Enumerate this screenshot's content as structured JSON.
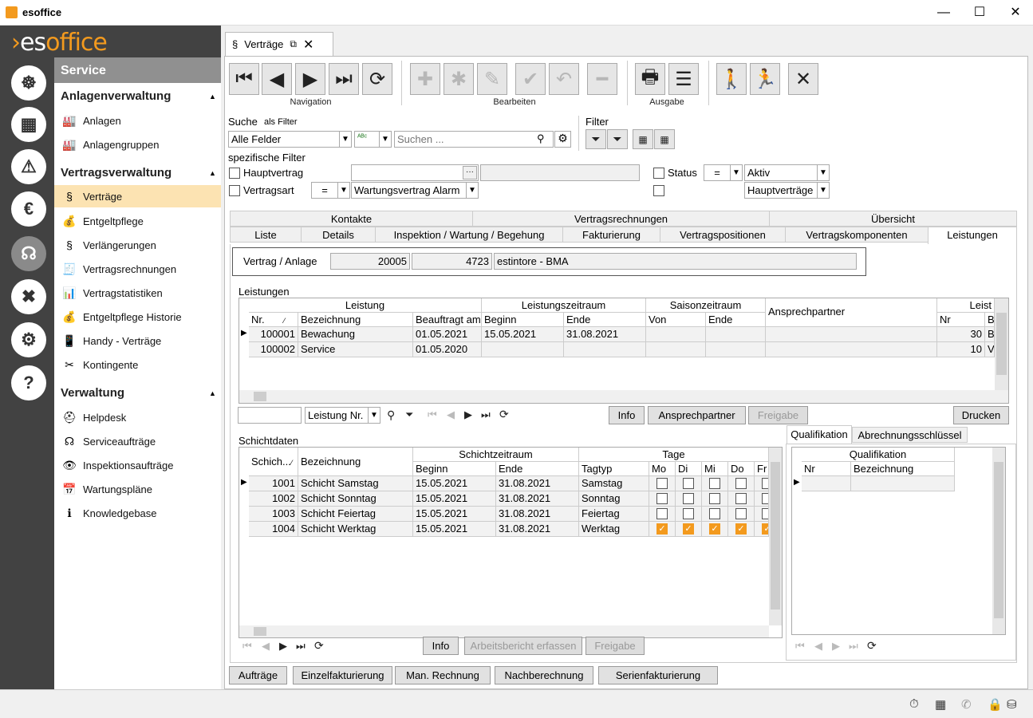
{
  "window": {
    "title": "esoffice",
    "min": "—",
    "max": "☐",
    "close": "✕"
  },
  "brand": {
    "logo_a": "es",
    "logo_b": "office"
  },
  "nav": {
    "title": "Service",
    "groups": [
      {
        "label": "Anlagenverwaltung",
        "items": [
          {
            "label": "Anlagen"
          },
          {
            "label": "Anlagengruppen"
          }
        ]
      },
      {
        "label": "Vertragsverwaltung",
        "items": [
          {
            "label": "Verträge"
          },
          {
            "label": "Entgeltpflege"
          },
          {
            "label": "Verlängerungen"
          },
          {
            "label": "Vertragsrechnungen"
          },
          {
            "label": "Vertragstatistiken"
          },
          {
            "label": "Entgeltpflege Historie"
          },
          {
            "label": "Handy - Verträge"
          },
          {
            "label": "Kontingente"
          }
        ]
      },
      {
        "label": "Verwaltung",
        "items": [
          {
            "label": "Helpdesk"
          },
          {
            "label": "Serviceaufträge"
          },
          {
            "label": "Inspektionsaufträge"
          },
          {
            "label": "Wartungspläne"
          },
          {
            "label": "Knowledgebase"
          }
        ]
      }
    ]
  },
  "doc_tab": {
    "label": "Verträge"
  },
  "toolbar": {
    "groups": [
      "Navigation",
      "Bearbeiten",
      "Ausgabe"
    ]
  },
  "search": {
    "label": "Suche",
    "as_filter": "als Filter",
    "field": "Alle Felder",
    "placeholder": "Suchen ...",
    "filter_label": "Filter"
  },
  "specific": {
    "title": "spezifische Filter",
    "hauptvertrag": "Hauptvertrag",
    "vertragsart": "Vertragsart",
    "op": "=",
    "vertragsart_value": "Wartungsvertrag Alarm",
    "status": "Status",
    "status_value": "Aktiv",
    "extra_value": "Hauptverträge"
  },
  "tabs": {
    "row1": [
      "Kontakte",
      "Vertragsrechnungen",
      "Übersicht"
    ],
    "row2": [
      "Liste",
      "Details",
      "Inspektion / Wartung / Begehung",
      "Fakturierung",
      "Vertragspositionen",
      "Vertragskomponenten",
      "Leistungen"
    ]
  },
  "contract": {
    "label": "Vertrag / Anlage",
    "vertrag": "20005",
    "anlage": "4723",
    "name": "estintore - BMA"
  },
  "leistungen": {
    "title": "Leistungen",
    "groups": {
      "leistung": "Leistung",
      "zeitraum": "Leistungszeitraum",
      "saison": "Saisonzeitraum",
      "ansprech": "Ansprechpartner",
      "leist": "Leist"
    },
    "cols": {
      "nr": "Nr.",
      "bez": "Bezeichnung",
      "beauftragt": "Beauftragt am",
      "beginn": "Beginn",
      "ende": "Ende",
      "von": "Von",
      "ende2": "Ende",
      "nr2": "Nr",
      "b": "B"
    },
    "rows": [
      {
        "nr": "100001",
        "bez": "Bewachung",
        "beauftragt": "01.05.2021",
        "beginn": "15.05.2021",
        "ende": "31.08.2021",
        "nr2": "30",
        "b": "B"
      },
      {
        "nr": "100002",
        "bez": "Service",
        "beauftragt": "01.05.2020",
        "beginn": "",
        "ende": "",
        "nr2": "10",
        "b": "V"
      }
    ],
    "sort_field": "Leistung Nr.",
    "buttons": {
      "info": "Info",
      "ansprech": "Ansprechpartner",
      "freigabe": "Freigabe",
      "drucken": "Drucken"
    }
  },
  "schicht": {
    "title": "Schichtdaten",
    "groups": {
      "zeitraum": "Schichtzeitraum",
      "tage": "Tage"
    },
    "cols": {
      "nr": "Schich...",
      "bez": "Bezeichnung",
      "beginn": "Beginn",
      "ende": "Ende",
      "tagtyp": "Tagtyp",
      "mo": "Mo",
      "di": "Di",
      "mi": "Mi",
      "do": "Do",
      "fr": "Fr"
    },
    "rows": [
      {
        "nr": "1001",
        "bez": "Schicht Samstag",
        "beginn": "15.05.2021",
        "ende": "31.08.2021",
        "tagtyp": "Samstag",
        "days": [
          false,
          false,
          false,
          false,
          false
        ]
      },
      {
        "nr": "1002",
        "bez": "Schicht Sonntag",
        "beginn": "15.05.2021",
        "ende": "31.08.2021",
        "tagtyp": "Sonntag",
        "days": [
          false,
          false,
          false,
          false,
          false
        ]
      },
      {
        "nr": "1003",
        "bez": "Schicht Feiertag",
        "beginn": "15.05.2021",
        "ende": "31.08.2021",
        "tagtyp": "Feiertag",
        "days": [
          false,
          false,
          false,
          false,
          false
        ]
      },
      {
        "nr": "1004",
        "bez": "Schicht Werktag",
        "beginn": "15.05.2021",
        "ende": "31.08.2021",
        "tagtyp": "Werktag",
        "days": [
          true,
          true,
          true,
          true,
          true
        ]
      }
    ],
    "buttons": {
      "info": "Info",
      "bericht": "Arbeitsbericht erfassen",
      "freigabe": "Freigabe"
    }
  },
  "quali": {
    "tabs": [
      "Qualifikation",
      "Abrechnungsschlüssel"
    ],
    "group": "Qualifikation",
    "cols": {
      "nr": "Nr",
      "bez": "Bezeichnung"
    }
  },
  "bottom_buttons": [
    "Aufträge",
    "Einzelfakturierung",
    "Man. Rechnung",
    "Nachberechnung",
    "Serienfakturierung"
  ]
}
